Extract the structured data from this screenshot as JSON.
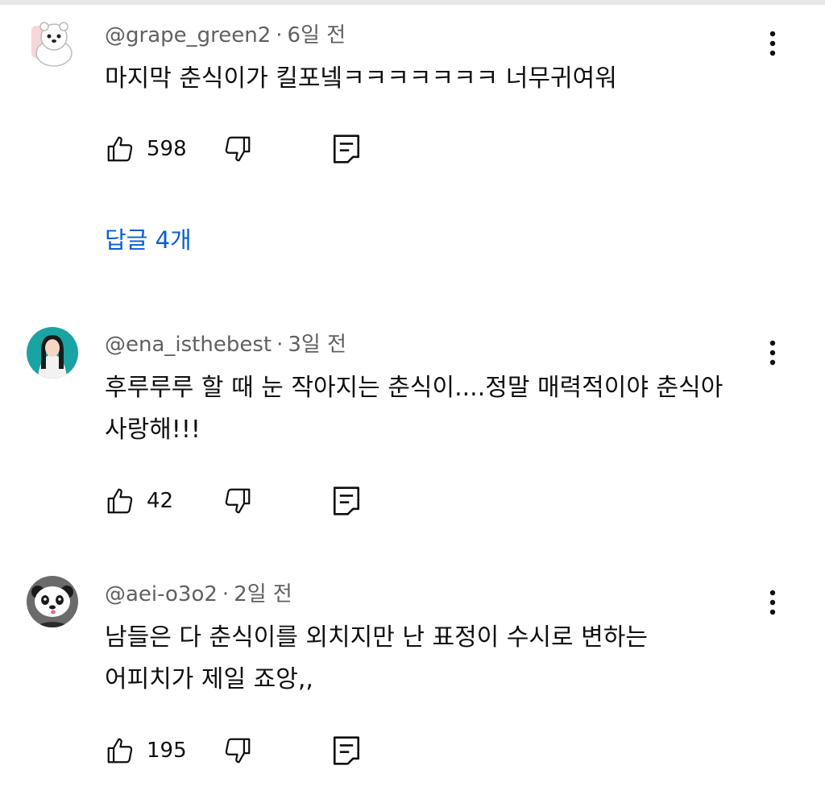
{
  "comments": [
    {
      "handle": "@grape_green2",
      "separator": "·",
      "time": "6일 전",
      "text": "마지막 춘식이가 킬포넼ㅋㅋㅋㅋㅋㅋㅋ 너무귀여워",
      "likes": "598"
    },
    {
      "handle": "@ena_isthebest",
      "separator": "·",
      "time": "3일 전",
      "text": "후루루루 할 때 눈 작아지는 춘식이....정말 매력적이야 춘식아\n사랑해!!!",
      "likes": "42"
    },
    {
      "handle": "@aei-o3o2",
      "separator": "·",
      "time": "2일 전",
      "text": "남들은 다 춘식이를 외치지만 난 표정이 수시로 변하는\n어피치가 제일 죠앙,,",
      "likes": "195"
    }
  ],
  "replies_link": "답글 4개",
  "colors": {
    "link": "#065fd4",
    "meta": "#606060",
    "text": "#0f0f0f"
  },
  "icons": {
    "like": "thumbs-up-icon",
    "dislike": "thumbs-down-icon",
    "reply": "reply-comment-icon",
    "menu": "more-vertical-icon"
  }
}
